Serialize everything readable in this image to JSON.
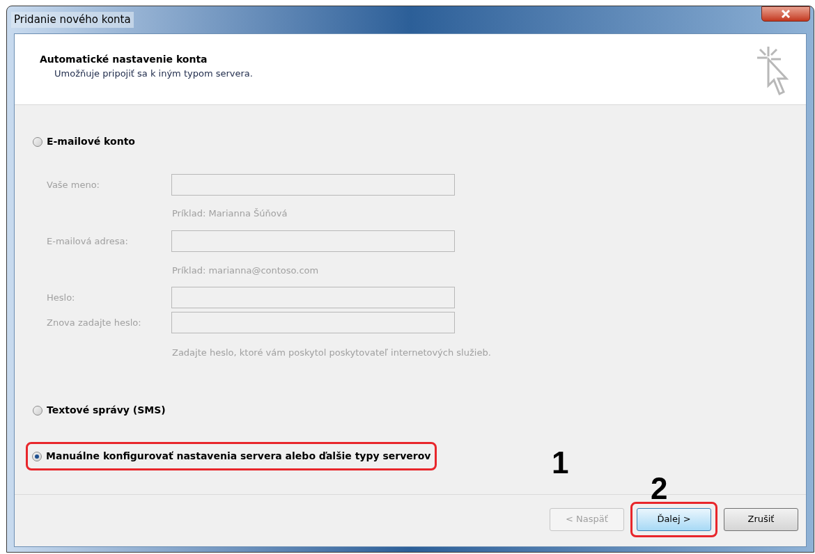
{
  "window": {
    "title": "Pridanie nového konta"
  },
  "header": {
    "title": "Automatické nastavenie konta",
    "subtitle": "Umožňuje pripojiť sa k iným typom servera."
  },
  "options": [
    {
      "label": "E-mailové konto",
      "selected": false,
      "highlighted": false
    },
    {
      "label": "Textové správy (SMS)",
      "selected": false,
      "highlighted": false
    },
    {
      "label": "Manuálne konfigurovať nastavenia servera alebo ďalšie typy serverov",
      "selected": true,
      "highlighted": true
    }
  ],
  "fields": [
    {
      "label": "Vaše meno:",
      "hint": "Príklad: Marianna Šúňová",
      "disabled": true
    },
    {
      "label": "E-mailová adresa:",
      "hint": "Príklad: marianna@contoso.com",
      "disabled": true
    },
    {
      "label": "Heslo:",
      "disabled": true
    },
    {
      "label": "Znova zadajte heslo:",
      "hint": "Zadajte heslo, ktoré vám poskytol poskytovateľ internetových služieb.",
      "disabled": true
    }
  ],
  "buttons": [
    {
      "label": "< Naspäť",
      "disabled": true,
      "highlighted": false
    },
    {
      "label": "Ďalej >",
      "disabled": false,
      "highlighted": true
    },
    {
      "label": "Zrušiť",
      "disabled": false,
      "highlighted": false
    }
  ],
  "annotations": [
    "1",
    "2"
  ]
}
